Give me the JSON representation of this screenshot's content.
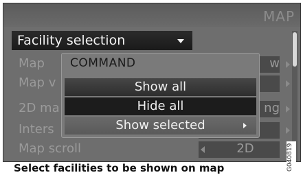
{
  "titlebar": {
    "brand": "MAP"
  },
  "header": {
    "label": "Facility selection"
  },
  "rows": [
    {
      "label": "Map",
      "value": "w"
    },
    {
      "label": "Map v",
      "value": ""
    },
    {
      "label": "2D ma",
      "value": "ng"
    },
    {
      "label": "Inters",
      "value": ""
    },
    {
      "label": "Map scroll",
      "value": "2D"
    }
  ],
  "popup": {
    "title": "COMMAND",
    "items": [
      {
        "label": "Show all"
      },
      {
        "label": "Hide all"
      },
      {
        "label": "Show selected"
      }
    ]
  },
  "hint": "Select facilities to be shown on map",
  "ref_code": "G040819"
}
